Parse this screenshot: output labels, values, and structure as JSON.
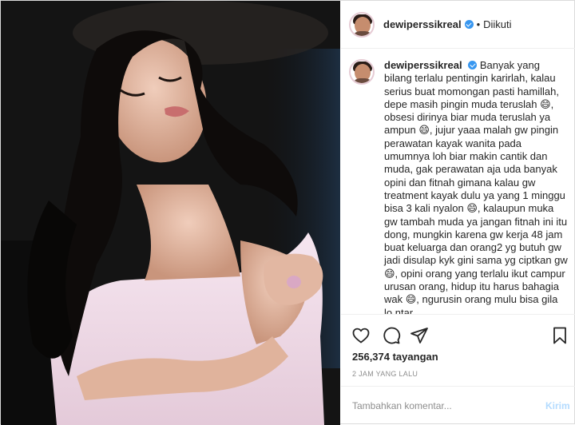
{
  "header": {
    "username": "dewiperssikreal",
    "separator": "•",
    "follow_status": "Diikuti"
  },
  "caption": {
    "username": "dewiperssikreal",
    "text": "Banyak yang bilang terlalu pentingin karirlah, kalau serius buat momongan pasti hamillah, depe masih pingin muda teruslah 😄, obsesi dirinya biar muda teruslah ya ampun 😄, jujur yaaa malah gw pingin perawatan kayak wanita pada umumnya loh biar makin cantik dan muda, gak perawatan aja uda banyak opini dan fitnah gimana kalau gw treatment kayak dulu ya yang 1 minggu bisa 3 kali nyalon 😄, kalaupun muka gw tambah muda ya jangan fitnah ini itu dong, mungkin karena gw kerja 48 jam buat keluarga dan orang2 yg butuh gw jadi disulap kyk gini sama yg ciptkan gw 😄, opini orang yang terlalu ikut campur urusan orang, hidup itu harus bahagia wak 😄, ngurusin orang mulu bisa gila lo ntar"
  },
  "stats": {
    "views": "256,374 tayangan",
    "time_ago": "2 JAM YANG LALU"
  },
  "comment": {
    "placeholder": "Tambahkan komentar...",
    "post_label": "Kirim"
  },
  "icons": {
    "like": "heart-icon",
    "comment": "comment-icon",
    "share": "share-icon",
    "save": "bookmark-icon",
    "verified": "verified-badge-icon"
  },
  "colors": {
    "verified": "#3897f0",
    "post_button_disabled": "#b3dbff",
    "muted_text": "#8e8e8e"
  }
}
